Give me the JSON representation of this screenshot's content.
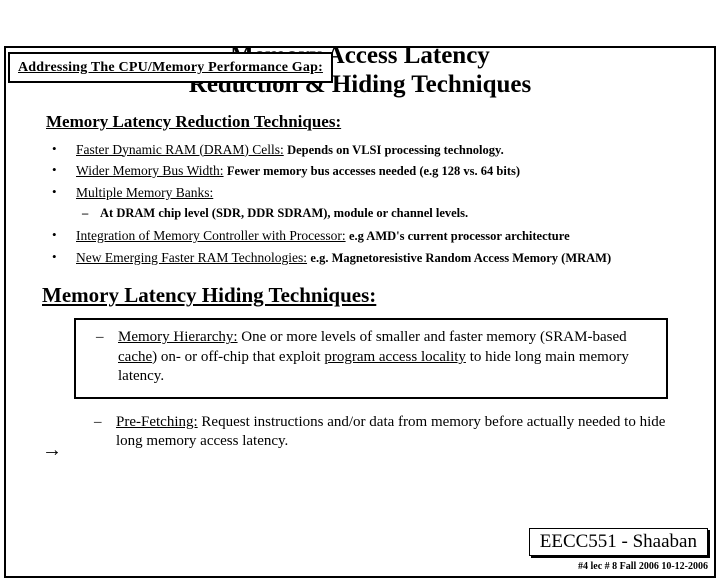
{
  "supertitle": "Addressing The CPU/Memory Performance Gap:",
  "title_line1": "Memory Access Latency",
  "title_line2": "Reduction & Hiding Techniques",
  "section1": {
    "heading": "Memory Latency Reduction Techniques:",
    "items": {
      "i0": {
        "label": "Faster Dynamic RAM (DRAM) Cells:",
        "note": "Depends on VLSI processing technology."
      },
      "i1": {
        "label": "Wider Memory Bus Width:",
        "note": "Fewer memory bus accesses needed  (e.g 128 vs. 64 bits)"
      },
      "i2": {
        "label": "Multiple Memory Banks:",
        "sub": "At DRAM chip level (SDR, DDR SDRAM), module or channel levels."
      },
      "i3": {
        "label": "Integration of Memory Controller with Processor:",
        "note": "e.g AMD's current processor architecture"
      },
      "i4": {
        "label": "New Emerging Faster RAM Technologies:",
        "note": "e.g.  Magnetoresistive Random Access Memory (MRAM)"
      }
    }
  },
  "section2": {
    "heading": "Memory Latency Hiding Techniques:",
    "hier": {
      "label": "Memory Hierarchy:",
      "text_a": " One or more levels of smaller and faster memory (SRAM-based ",
      "text_b": "cache",
      "text_c": ") on- or off-chip that exploit ",
      "text_d": "program access locality",
      "text_e": " to hide long main memory latency."
    },
    "pref": {
      "label": "Pre-Fetching:",
      "text": "  Request instructions and/or data from memory before actually needed to hide long memory access latency."
    }
  },
  "footer": {
    "badge": "EECC551 - Shaaban",
    "meta": "#4   lec # 8    Fall 2006   10-12-2006"
  }
}
